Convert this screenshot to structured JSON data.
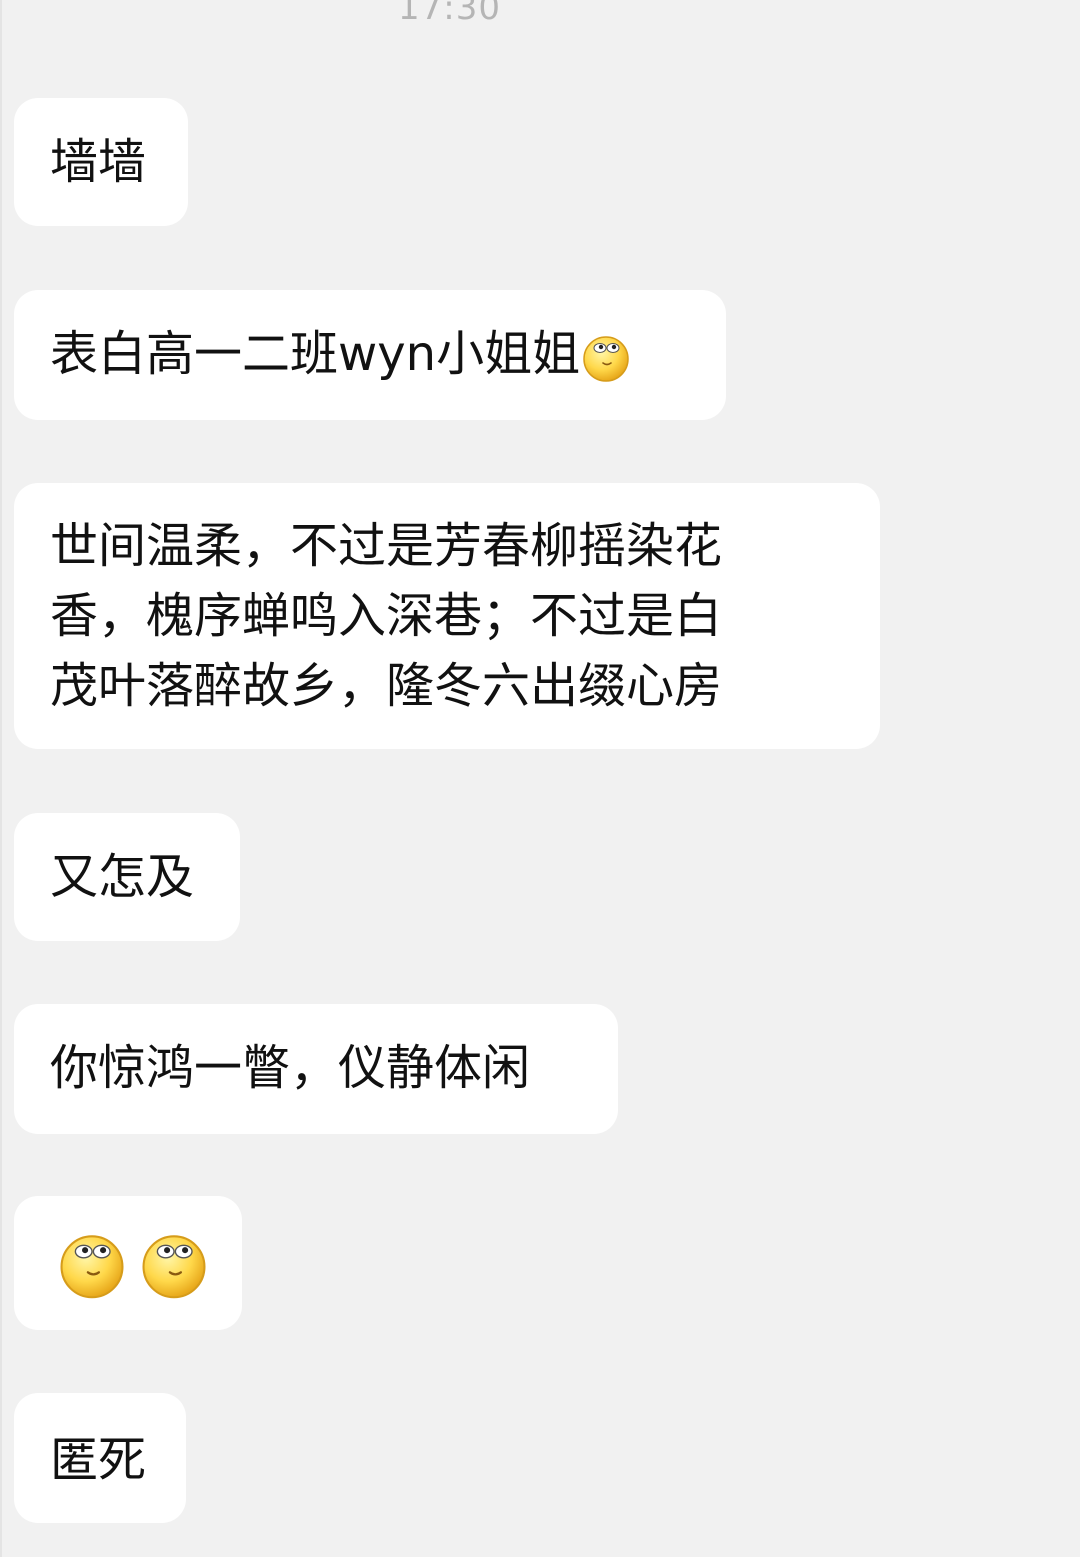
{
  "header": {
    "timestamp": "17:30"
  },
  "messages": [
    {
      "text": "墙墙"
    },
    {
      "text": "表白高一二班wyn小姐姐",
      "emoji": "dizzy-eyes-smiley-emoji"
    },
    {
      "lines": [
        "世间温柔，不过是芳春柳摇染花",
        "香，槐序蝉鸣入深巷；不过是白",
        "茂叶落醉故乡，隆冬六出缀心房"
      ]
    },
    {
      "text": "又怎及"
    },
    {
      "text": "你惊鸿一瞥，仪静体闲"
    },
    {
      "emojis": [
        "dizzy-eyes-smiley-emoji",
        "dizzy-eyes-smiley-emoji"
      ]
    },
    {
      "text": "匿死"
    }
  ],
  "colors": {
    "background": "#f1f1f1",
    "bubble": "#ffffff",
    "text": "#111111",
    "timestamp": "#b5b5b5"
  }
}
